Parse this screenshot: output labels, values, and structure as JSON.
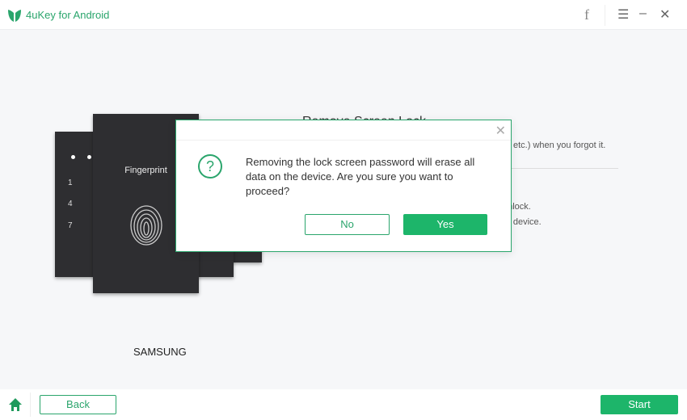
{
  "app": {
    "title": "4uKey for Android",
    "accent": "#1db56a"
  },
  "titlebar": {
    "icons": [
      "facebook-icon",
      "menu-icon",
      "minimize-icon",
      "close-icon"
    ],
    "facebook": "f",
    "menu": "☰",
    "minimize": "–",
    "close": "✕"
  },
  "illustration": {
    "fingerprint_label": "Fingerprint",
    "digits": [
      "1",
      "4",
      "7"
    ],
    "brand": "SAMSUNG"
  },
  "background": {
    "title": "Remove Screen Lock",
    "line1": "etc.) when you forgot it.",
    "line2": "unlock.",
    "line3": "ur device."
  },
  "dialog": {
    "message": "Removing the lock screen password will erase all data on the device. Are you sure you want to proceed?",
    "icon": "?",
    "close": "✕",
    "no_label": "No",
    "yes_label": "Yes"
  },
  "footer": {
    "back_label": "Back",
    "start_label": "Start"
  }
}
